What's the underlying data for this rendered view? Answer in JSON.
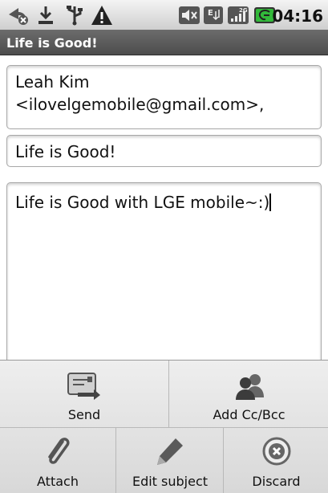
{
  "status_bar": {
    "time": "04:16",
    "icons": [
      "missed-call-icon",
      "download-icon",
      "usb-debug-icon",
      "warning-icon",
      "mute-icon",
      "edge-signal-icon",
      "signal-bars-icon",
      "battery-charging-icon"
    ],
    "edge_label": "E",
    "network_label": "2G"
  },
  "title_bar": {
    "title": "Life is Good!"
  },
  "compose": {
    "to": "Leah Kim <ilovelgemobile@gmail.com>,",
    "subject": "Life is Good!",
    "body": "Life is Good with LGE mobile~:)"
  },
  "menu": {
    "send": {
      "label": "Send",
      "icon": "send-icon"
    },
    "add_cc_bcc": {
      "label": "Add Cc/Bcc",
      "icon": "contacts-icon"
    },
    "attach": {
      "label": "Attach",
      "icon": "paperclip-icon"
    },
    "edit_subject": {
      "label": "Edit subject",
      "icon": "pencil-icon"
    },
    "discard": {
      "label": "Discard",
      "icon": "discard-icon"
    }
  },
  "colors": {
    "status_bar": "#dcdcdc",
    "title_bar": "#5c5c5c",
    "menu": "#e4e4e4",
    "battery": "#32b93a"
  }
}
